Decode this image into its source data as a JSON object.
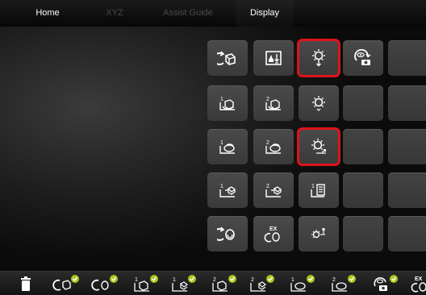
{
  "nav": {
    "tabs": [
      {
        "label": "Home",
        "state": "active"
      },
      {
        "label": "XYZ",
        "state": "disabled"
      },
      {
        "label": "Assist Guide",
        "state": "disabled"
      },
      {
        "label": "Display",
        "state": "selected"
      }
    ]
  },
  "colors": {
    "highlight": "#e0121a",
    "check": "#a8c81e",
    "accent_orange": "#e8a000"
  },
  "grid": {
    "rows": [
      [
        "rotate-view-icon",
        "layer-transparency-icon",
        "light-bulb-icon",
        "camera-view-icon",
        "empty"
      ],
      [
        "rotate-solid-icon",
        "rotate-solid-2-icon",
        "light-direction-icon",
        "empty",
        "empty"
      ],
      [
        "rotate-ring-icon",
        "rotate-ring-2-icon",
        "light-reset-icon",
        "empty",
        "empty"
      ],
      [
        "rotate-plane-1-icon",
        "rotate-plane-2-icon",
        "layer-stack-icon",
        "empty",
        "empty"
      ],
      [
        "rotate-object-icon",
        "rotate-ex-icon",
        "light-adjust-icon",
        "empty",
        "empty"
      ]
    ],
    "highlighted": [
      "light-bulb-icon",
      "light-reset-icon"
    ]
  },
  "bottom_bar": {
    "items": [
      "trash-icon",
      "rotate-view-check-icon",
      "rotate-object-check-icon",
      "rotate-solid-check-icon",
      "rotate-plane-1-check-icon",
      "rotate-solid-2-check-icon",
      "rotate-plane-2-check-icon",
      "rotate-ring-check-icon",
      "rotate-ring-2-check-icon",
      "camera-view-check-icon",
      "rotate-ex-icon"
    ]
  }
}
